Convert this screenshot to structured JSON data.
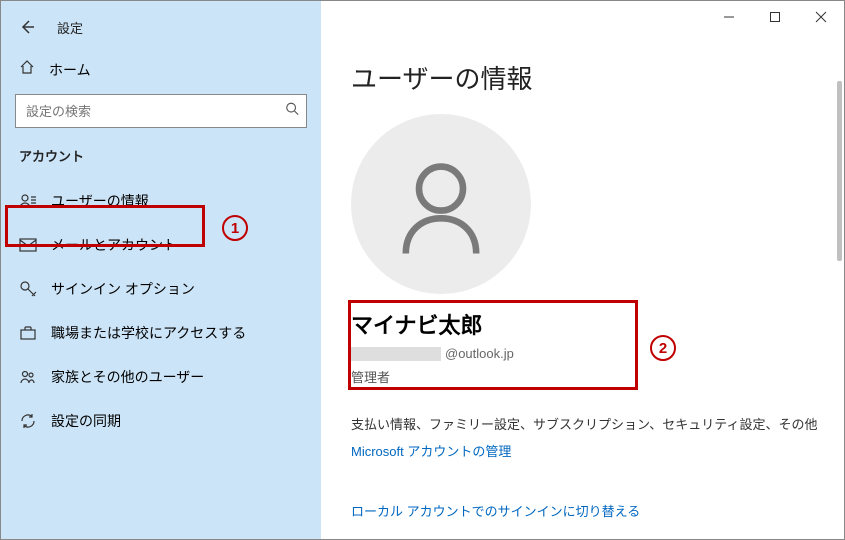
{
  "window": {
    "title": "設定"
  },
  "sidebar": {
    "home": "ホーム",
    "search_placeholder": "設定の検索",
    "group": "アカウント",
    "items": [
      {
        "label": "ユーザーの情報"
      },
      {
        "label": "メールとアカウント"
      },
      {
        "label": "サインイン オプション"
      },
      {
        "label": "職場または学校にアクセスする"
      },
      {
        "label": "家族とその他のユーザー"
      },
      {
        "label": "設定の同期"
      }
    ]
  },
  "page": {
    "title": "ユーザーの情報",
    "user_name": "マイナビ太郎",
    "email_domain": "@outlook.jp",
    "role": "管理者",
    "description": "支払い情報、ファミリー設定、サブスクリプション、セキュリティ設定、その他",
    "link_manage": "Microsoft アカウントの管理",
    "link_local": "ローカル アカウントでのサインインに切り替える"
  },
  "annotations": {
    "one": "1",
    "two": "2"
  }
}
